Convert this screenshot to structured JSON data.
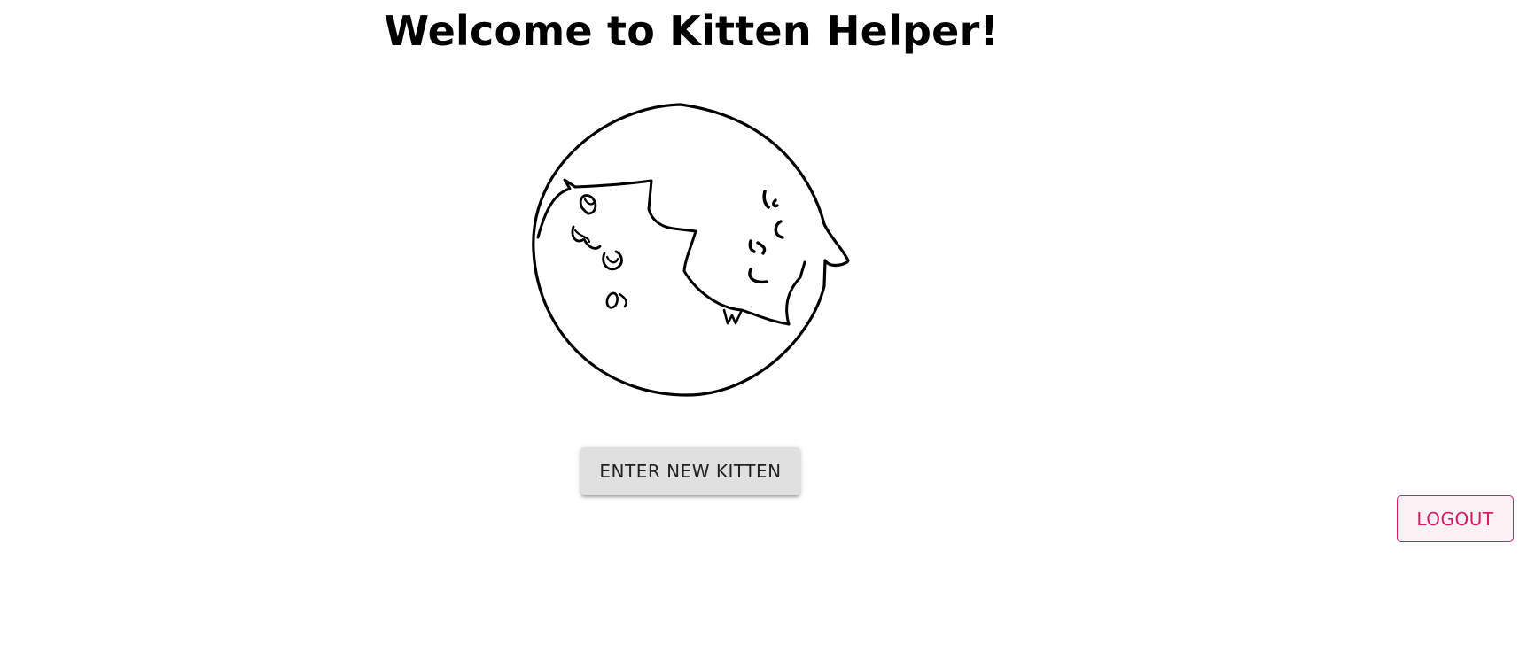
{
  "header": {
    "title": "Welcome to Kitten Helper!"
  },
  "illustration": {
    "icon": "sleeping-cats-icon"
  },
  "actions": {
    "enter_new_kitten_label": "ENTER NEW KITTEN",
    "logout_label": "LOGOUT"
  },
  "colors": {
    "logout_accent": "#d81b60",
    "logout_background": "#fdf1f6",
    "enter_button_background": "#e0e0e0"
  }
}
